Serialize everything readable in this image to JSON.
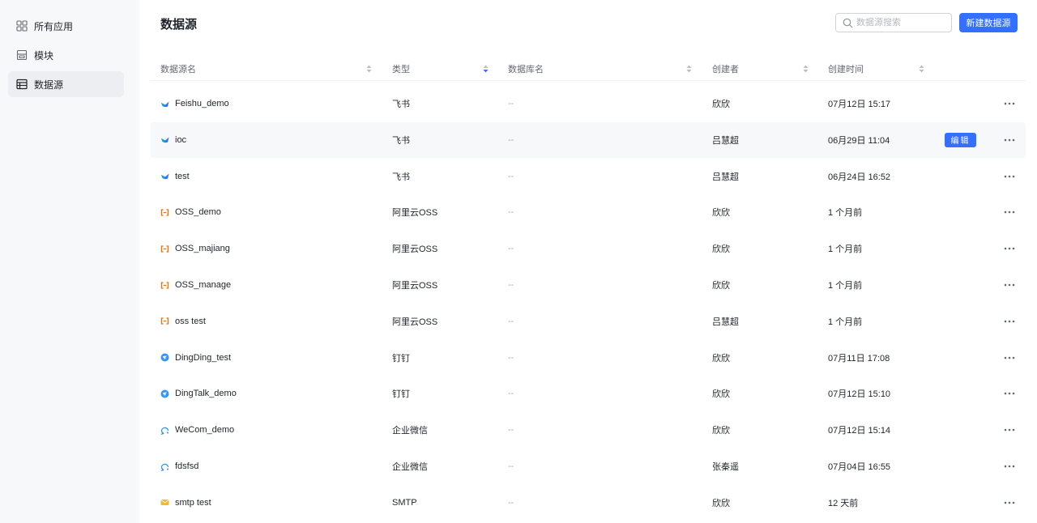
{
  "sidebar": {
    "items": [
      {
        "label": "所有应用",
        "icon": "grid-icon"
      },
      {
        "label": "模块",
        "icon": "module-icon"
      },
      {
        "label": "数据源",
        "icon": "table-icon",
        "active": true
      }
    ]
  },
  "page": {
    "title": "数据源",
    "search_placeholder": "数据源搜索",
    "new_button": "新建数据源"
  },
  "table": {
    "columns": [
      "数据源名",
      "类型",
      "数据库名",
      "创建者",
      "创建时间"
    ],
    "edit_label": "编辑",
    "rows": [
      {
        "name": "Feishu_demo",
        "type": "飞书",
        "db": "--",
        "creator": "欣欣",
        "time": "07月12日 15:17",
        "icon": "feishu-icon"
      },
      {
        "name": "ioc",
        "type": "飞书",
        "db": "--",
        "creator": "吕慧超",
        "time": "06月29日 11:04",
        "icon": "feishu-icon",
        "hover": true
      },
      {
        "name": "test",
        "type": "飞书",
        "db": "--",
        "creator": "吕慧超",
        "time": "06月24日 16:52",
        "icon": "feishu-icon"
      },
      {
        "name": "OSS_demo",
        "type": "阿里云OSS",
        "db": "--",
        "creator": "欣欣",
        "time": "1 个月前",
        "icon": "aliyun-icon"
      },
      {
        "name": "OSS_majiang",
        "type": "阿里云OSS",
        "db": "--",
        "creator": "欣欣",
        "time": "1 个月前",
        "icon": "aliyun-icon"
      },
      {
        "name": "OSS_manage",
        "type": "阿里云OSS",
        "db": "--",
        "creator": "欣欣",
        "time": "1 个月前",
        "icon": "aliyun-icon"
      },
      {
        "name": "oss test",
        "type": "阿里云OSS",
        "db": "--",
        "creator": "吕慧超",
        "time": "1 个月前",
        "icon": "aliyun-icon"
      },
      {
        "name": "DingDing_test",
        "type": "钉钉",
        "db": "--",
        "creator": "欣欣",
        "time": "07月11日 17:08",
        "icon": "dingtalk-icon"
      },
      {
        "name": "DingTalk_demo",
        "type": "钉钉",
        "db": "--",
        "creator": "欣欣",
        "time": "07月12日 15:10",
        "icon": "dingtalk-icon"
      },
      {
        "name": "WeCom_demo",
        "type": "企业微信",
        "db": "--",
        "creator": "欣欣",
        "time": "07月12日 15:14",
        "icon": "wecom-icon"
      },
      {
        "name": "fdsfsd",
        "type": "企业微信",
        "db": "--",
        "creator": "张秦遥",
        "time": "07月04日 16:55",
        "icon": "wecom-icon"
      },
      {
        "name": "smtp test",
        "type": "SMTP",
        "db": "--",
        "creator": "欣欣",
        "time": "12 天前",
        "icon": "mail-icon"
      }
    ]
  },
  "colors": {
    "primary": "#3370ff",
    "sidebar_bg": "#f7f8fa",
    "hover_bg": "#f7f8fa",
    "feishu": "#3370ff",
    "aliyun": "#ff6a00",
    "dingtalk": "#3296fa",
    "wecom": "#2b8ef0",
    "mail": "#f5b82e"
  }
}
